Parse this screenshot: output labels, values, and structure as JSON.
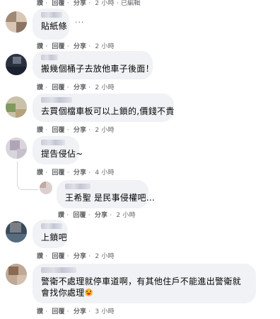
{
  "action_labels": {
    "like": "讚",
    "reply": "回覆",
    "share": "分享"
  },
  "comments": [
    {
      "text": "",
      "time": "2 小時",
      "extra": "· 已編輯"
    },
    {
      "text": "貼紙條",
      "time": "2 小時"
    },
    {
      "text": "搬幾個桶子去放他車子後面！",
      "time": "2 小時"
    },
    {
      "text": "去買個檔車板可以上鎖的,價錢不貴",
      "time": "2 小時"
    },
    {
      "text": "提告侵佔~",
      "time": "4 小時"
    },
    {
      "text": "王希聖 是民事侵權吧...",
      "time": "2 小時"
    },
    {
      "text": "上鎖吧",
      "time": "2 小時"
    },
    {
      "text": "警衛不處理就停車道啊，有其他住戶不能進出警衛就會找你處理",
      "time": "3 小時"
    }
  ],
  "more_options": "···",
  "emoji": "grinning-face-with-tongue"
}
